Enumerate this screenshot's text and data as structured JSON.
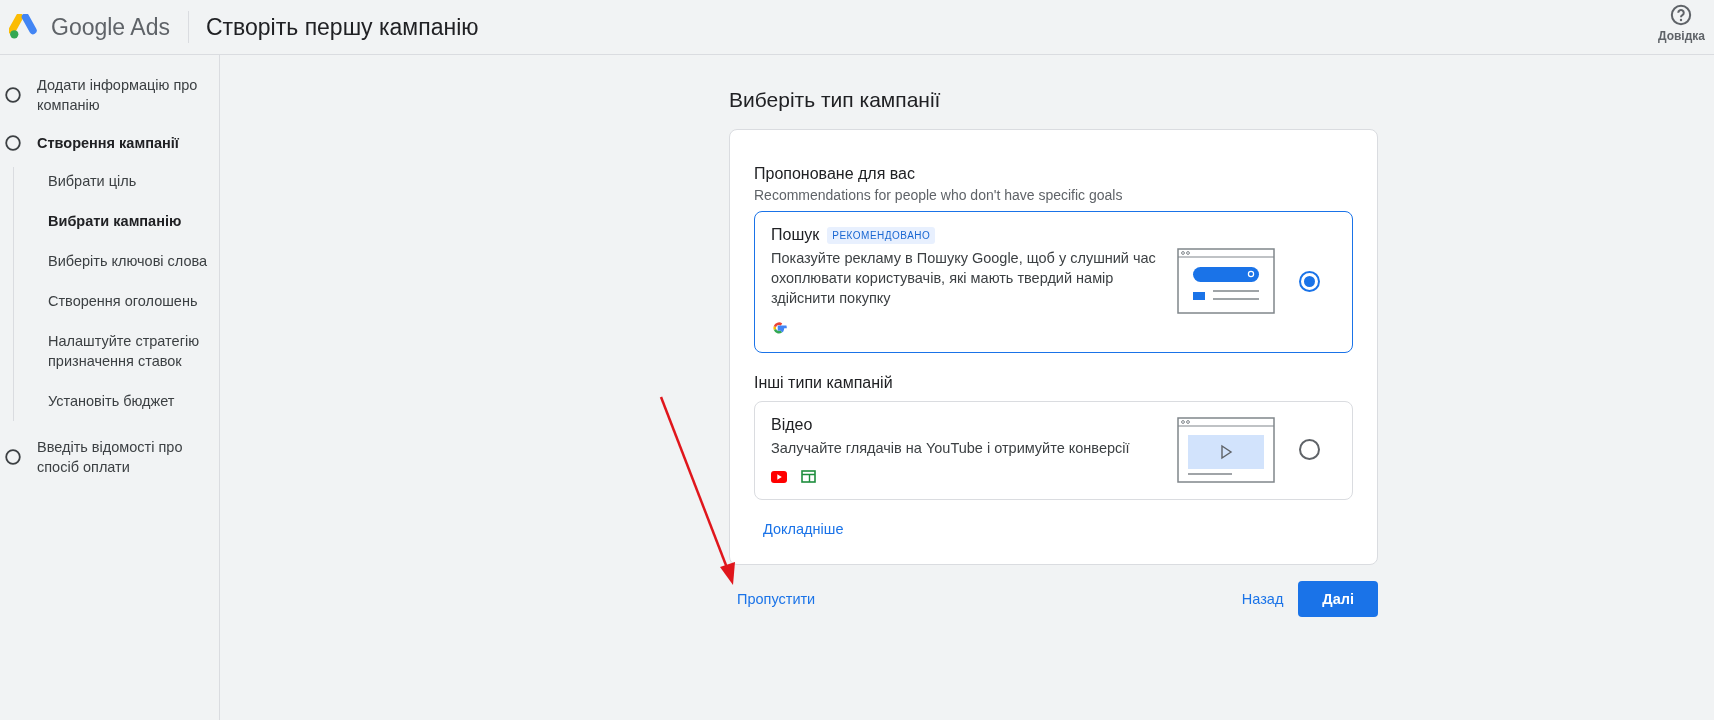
{
  "header": {
    "product": "Google Ads",
    "title": "Створіть першу кампанію",
    "help": "Довідка"
  },
  "steps": [
    {
      "label": "Додати інформацію про компанію",
      "selected": false
    },
    {
      "label": "Створення кампанії",
      "selected": true,
      "children": [
        {
          "label": "Вибрати ціль",
          "selected": false
        },
        {
          "label": "Вибрати кампанію",
          "selected": true
        },
        {
          "label": "Виберіть ключові слова",
          "selected": false
        },
        {
          "label": "Створення оголошень",
          "selected": false
        },
        {
          "label": "Налаштуйте стратегію призначення ставок",
          "selected": false
        },
        {
          "label": "Установіть бюджет",
          "selected": false
        }
      ]
    },
    {
      "label": "Введіть відомості про спосіб оплати",
      "selected": false
    }
  ],
  "page_title": "Виберіть тип кампанії",
  "sections": [
    {
      "heading": "Пропоноване для вас",
      "subheading": "Recommendations for people who don't have specific goals",
      "options": [
        {
          "kind": "search",
          "title": "Пошук",
          "badge": "РЕКОМЕНДОВАНО",
          "description": "Показуйте рекламу в Пошуку Google, щоб у слушний час охоплювати користувачів, які мають твердий намір здійснити покупку",
          "channels": [
            {
              "kind": "google"
            }
          ],
          "selected": true
        }
      ]
    },
    {
      "heading": "Інші типи кампаній",
      "options": [
        {
          "kind": "video",
          "title": "Відео",
          "description": "Залучайте глядачів на YouTube і отримуйте конверсії",
          "channels": [
            {
              "kind": "youtube"
            },
            {
              "kind": "display"
            }
          ],
          "selected": false
        }
      ]
    }
  ],
  "learn_more": "Докладніше",
  "actions": {
    "skip": "Пропустити",
    "back": "Назад",
    "next": "Далі"
  }
}
